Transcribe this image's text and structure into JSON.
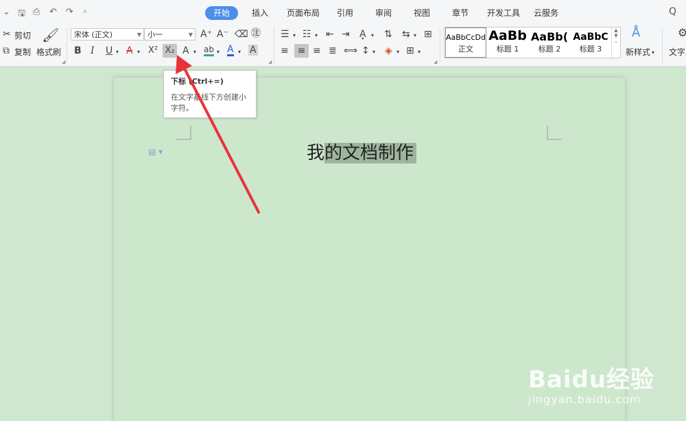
{
  "quick_access": {
    "collapse": "⌄",
    "save": "🖫",
    "print": "⎙",
    "undo": "↶",
    "redo": "↷",
    "more": "⩡"
  },
  "tabs": [
    {
      "label": "开始",
      "active": true
    },
    {
      "label": "插入"
    },
    {
      "label": "页面布局"
    },
    {
      "label": "引用"
    },
    {
      "label": "审阅"
    },
    {
      "label": "视图"
    },
    {
      "label": "章节"
    },
    {
      "label": "开发工具"
    },
    {
      "label": "云服务"
    }
  ],
  "search_text": "Q",
  "clipboard": {
    "cut": "剪切",
    "copy": "复制",
    "format_painter": "格式刷"
  },
  "font": {
    "name": "宋体 (正文)",
    "size": "小一"
  },
  "font_buttons": {
    "bold": "B",
    "italic": "I",
    "underline": "U",
    "strike": "A",
    "superscript": "X²",
    "subscript": "X₂",
    "text_effect": "A",
    "highlight": "ab",
    "font_color": "A",
    "char_shading": "A",
    "grow": "A⁺",
    "shrink": "A⁻",
    "clear": "⌫"
  },
  "styles": [
    {
      "sample": "AaBbCcDd",
      "name": "正文",
      "active": true
    },
    {
      "sample": "AaBb",
      "name": "标题 1"
    },
    {
      "sample": "AaBb(",
      "name": "标题 2"
    },
    {
      "sample": "AaBbC",
      "name": "标题 3"
    }
  ],
  "new_style": "新样式",
  "text_tools": "文字工",
  "tooltip": {
    "title": "下标 (Ctrl+=)",
    "body": "在文字基线下方创建小字符。"
  },
  "document": {
    "title_prefix": "我",
    "title_selected": "的文档制作"
  },
  "watermark": {
    "logo": "Baidu经验",
    "url": "jingyan.baidu.com"
  },
  "colors": {
    "accent": "#4a8fe8",
    "arrow": "#e8333a",
    "page": "#cde7cd"
  }
}
